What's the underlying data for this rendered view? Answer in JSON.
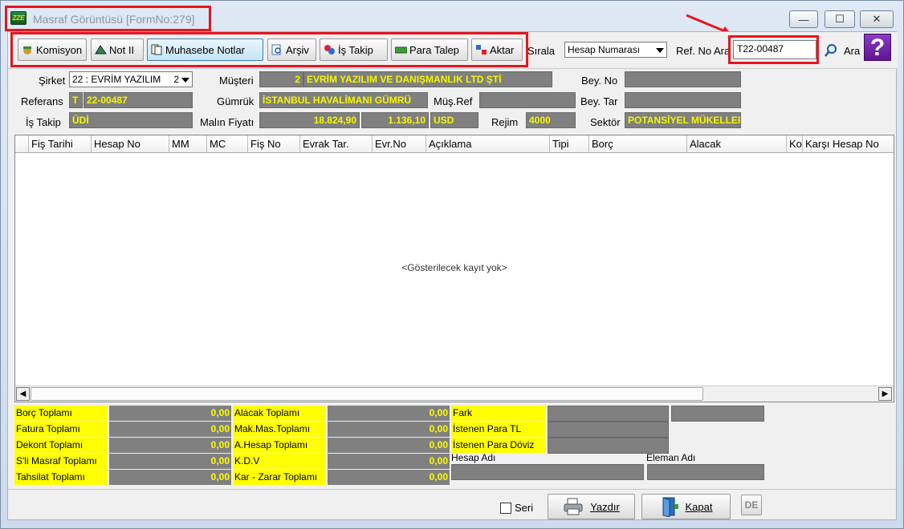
{
  "window": {
    "title": "Masraf Görüntüsü [FormNo:279]",
    "icon_text": "ZZE",
    "minimize": "—",
    "maximize": "☐",
    "close": "✕"
  },
  "toolbar": {
    "buttons": [
      "Komisyon",
      "Not II",
      "Muhasebe Notlar",
      "Arşiv",
      "İş Takip",
      "Para Talep",
      "Aktar"
    ],
    "sort_label": "Sırala",
    "sort_value": "Hesap Numarası",
    "ref_label": "Ref. No Ara",
    "ref_value": "T22-00487",
    "search_label": "Ara",
    "help": "?"
  },
  "form": {
    "sirket_label": "Şirket",
    "sirket_value": "22 : EVRİM YAZILIM",
    "sirket_suffix": "2",
    "musteri_label": "Müşteri",
    "musteri_code": "2",
    "musteri_name": "EVRİM YAZILIM VE DANIŞMANLIK LTD ŞTİ",
    "bey_no_label": "Bey. No",
    "referans_label": "Referans",
    "referans_prefix": "T",
    "referans_value": "22-00487",
    "gumruk_label": "Gümrük",
    "gumruk_value": "İSTANBUL HAVALİMANI GÜMRÜ",
    "mus_ref_label": "Müş.Ref",
    "bey_tar_label": "Bey. Tar",
    "is_takip_label": "İş Takip",
    "is_takip_value": "ÜDİ",
    "malin_fiyati_label": "Malın Fiyatı",
    "malin_fiyati_value": "18.824,90",
    "malin_fiyati_value2": "1.136,10",
    "currency": "USD",
    "rejim_label": "Rejim",
    "rejim_value": "4000",
    "sektor_label": "Sektör",
    "sektor_value": "POTANSİYEL MÜKELLEF"
  },
  "grid": {
    "columns": [
      "Fiş Tarihi",
      "Hesap No",
      "MM",
      "MC",
      "Fiş No",
      "Evrak Tar.",
      "Evr.No",
      "Açıklama",
      "Tipi",
      "Borç",
      "Alacak",
      "Ko",
      "Karşı Hesap No"
    ],
    "empty_text": "<Gösterilecek kayıt yok>",
    "scroll_left": "◀",
    "scroll_right": "▶"
  },
  "totals": {
    "left": [
      {
        "label": "Borç Toplamı",
        "value": "0,00"
      },
      {
        "label": "Fatura Toplamı",
        "value": "0,00"
      },
      {
        "label": "Dekont Toplamı",
        "value": "0,00"
      },
      {
        "label": "S'li Masraf Toplamı",
        "value": "0,00"
      },
      {
        "label": "Tahsilat Toplamı",
        "value": "0,00"
      }
    ],
    "mid": [
      {
        "label": "Alacak Toplamı",
        "value": "0,00"
      },
      {
        "label": "Mak.Mas.Toplamı",
        "value": "0,00"
      },
      {
        "label": "A.Hesap Toplamı",
        "value": "0,00"
      },
      {
        "label": "K.D.V",
        "value": "0,00"
      },
      {
        "label": "Kar - Zarar Toplamı",
        "value": "0,00"
      }
    ],
    "right": [
      "Fark",
      "İstenen Para TL",
      "İstenen Para Döviz"
    ],
    "hesap_adi_label": "Hesap Adı",
    "eleman_adi_label": "Eleman  Adı"
  },
  "bottom": {
    "seri_label": "Seri",
    "yazdir_label": "Yazdır",
    "kapat_label": "Kapat",
    "de_label": "DE"
  },
  "colors": {
    "highlight": "#e8141f",
    "field_gray": "#808080",
    "field_text": "#ffff00"
  }
}
